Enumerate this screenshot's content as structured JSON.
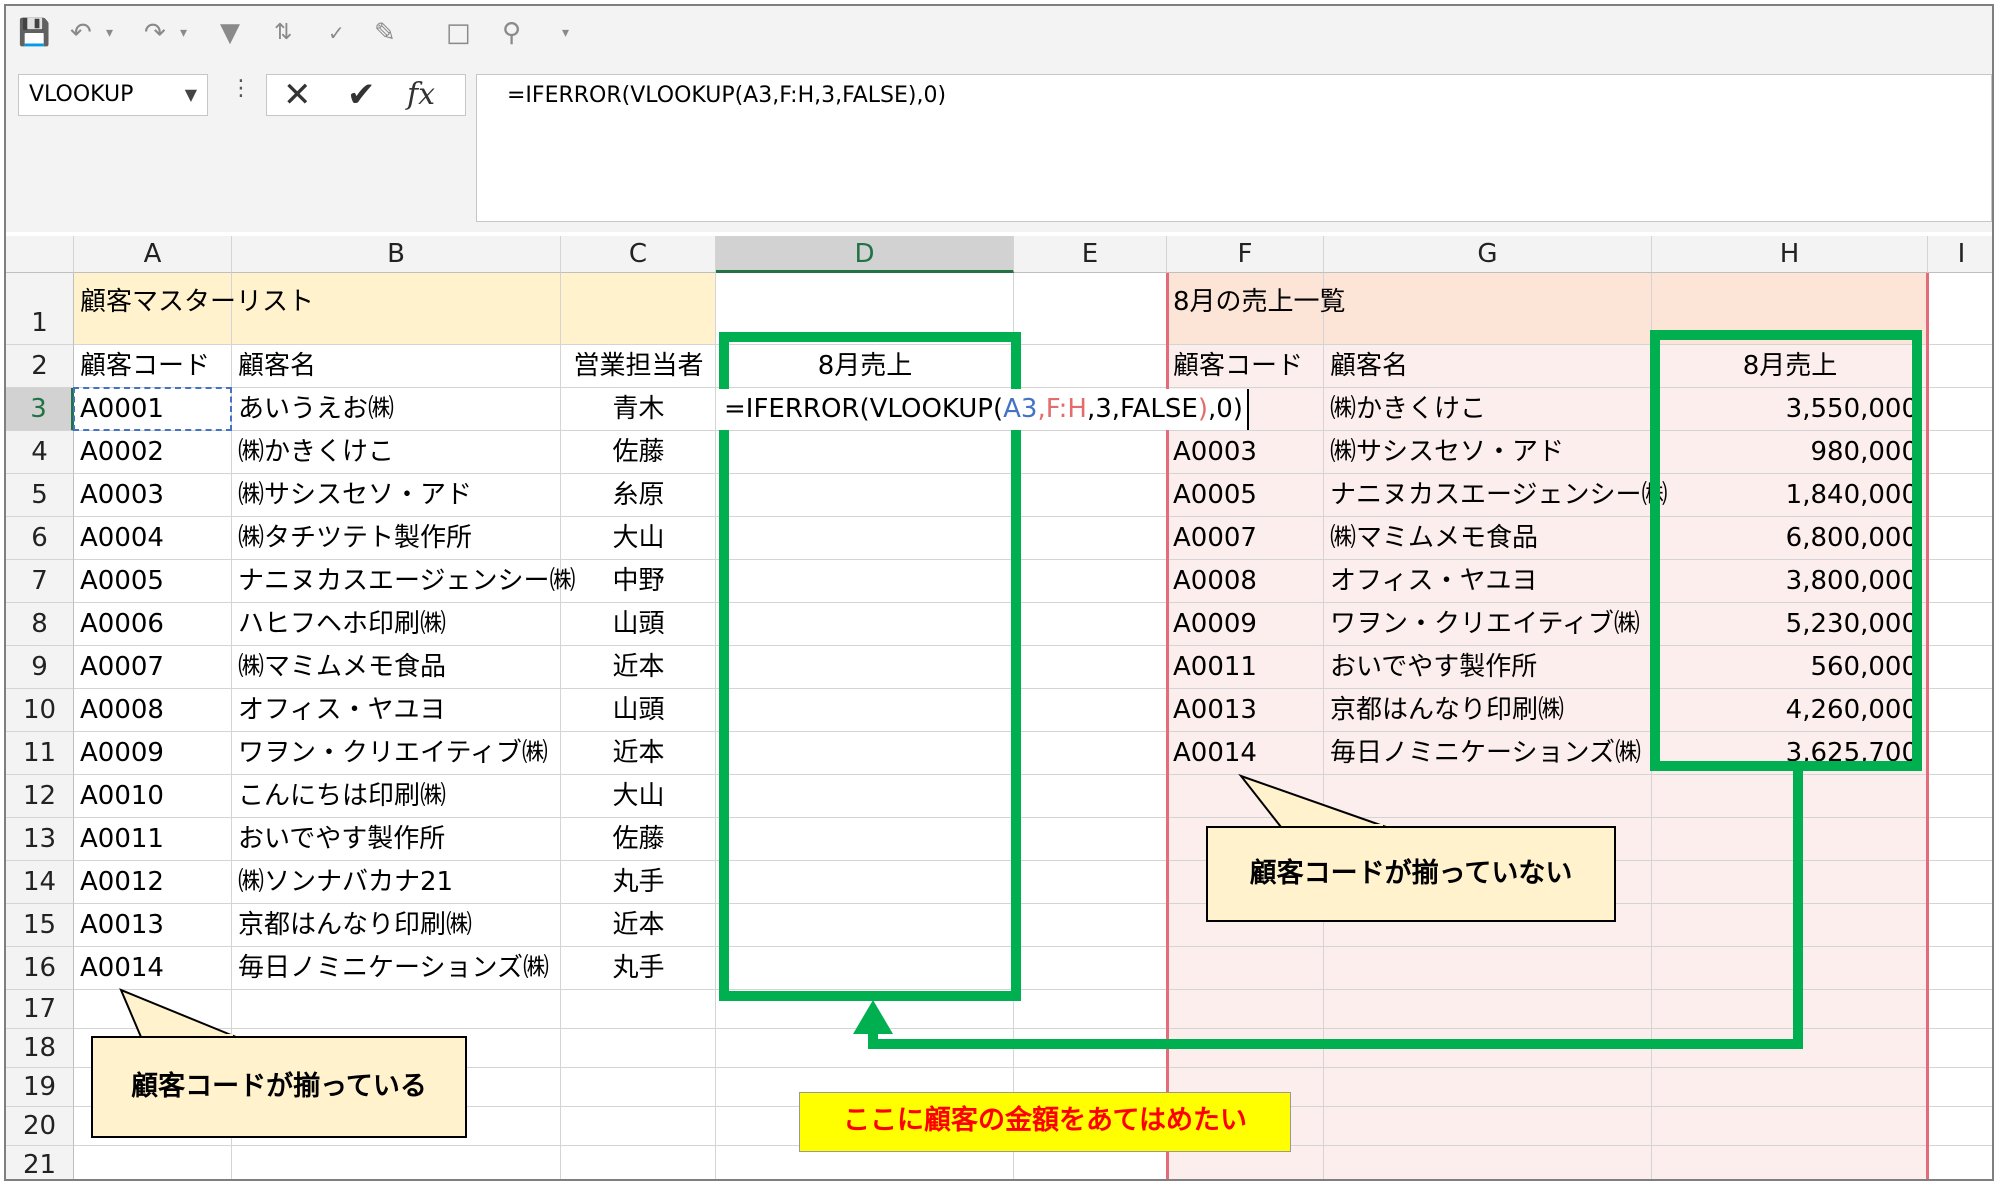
{
  "namebox": "VLOOKUP",
  "formula": "=IFERROR(VLOOKUP(A3,F:H,3,FALSE),0)",
  "editing": {
    "prefix": "=IFERROR(VLOOKUP(",
    "a3": "A3",
    "c1": ",",
    "fh": "F:H",
    "suffix1": ",3,FALSE",
    "paren": ")",
    "suffix2": ",0)"
  },
  "columns": [
    "A",
    "B",
    "C",
    "D",
    "E",
    "F",
    "G",
    "H",
    "I"
  ],
  "rows": [
    "1",
    "2",
    "3",
    "4",
    "5",
    "6",
    "7",
    "8",
    "9",
    "10",
    "11",
    "12",
    "13",
    "14",
    "15",
    "16",
    "17",
    "18",
    "19",
    "20",
    "21"
  ],
  "master": {
    "title": "顧客マスターリスト",
    "headers": {
      "code": "顧客コード",
      "name": "顧客名",
      "rep": "営業担当者",
      "sales": "8月売上"
    },
    "records": [
      {
        "code": "A0001",
        "name": "あいうえお㈱",
        "rep": "青木"
      },
      {
        "code": "A0002",
        "name": "㈱かきくけこ",
        "rep": "佐藤"
      },
      {
        "code": "A0003",
        "name": "㈱サシスセソ・アド",
        "rep": "糸原"
      },
      {
        "code": "A0004",
        "name": "㈱タチツテト製作所",
        "rep": "大山"
      },
      {
        "code": "A0005",
        "name": "ナニヌカスエージェンシー㈱",
        "rep": "中野"
      },
      {
        "code": "A0006",
        "name": "ハヒフヘホ印刷㈱",
        "rep": "山頭"
      },
      {
        "code": "A0007",
        "name": "㈱マミムメモ食品",
        "rep": "近本"
      },
      {
        "code": "A0008",
        "name": "オフィス・ヤユヨ",
        "rep": "山頭"
      },
      {
        "code": "A0009",
        "name": "ワヲン・クリエイティブ㈱",
        "rep": "近本"
      },
      {
        "code": "A0010",
        "name": "こんにちは印刷㈱",
        "rep": "大山"
      },
      {
        "code": "A0011",
        "name": "おいでやす製作所",
        "rep": "佐藤"
      },
      {
        "code": "A0012",
        "name": "㈱ソンナバカナ21",
        "rep": "丸手"
      },
      {
        "code": "A0013",
        "name": "京都はんなり印刷㈱",
        "rep": "近本"
      },
      {
        "code": "A0014",
        "name": "毎日ノミニケーションズ㈱",
        "rep": "丸手"
      }
    ]
  },
  "sales": {
    "title": "8月の売上一覧",
    "headers": {
      "code": "顧客コード",
      "name": "顧客名",
      "sales": "8月売上"
    },
    "records": [
      {
        "code": "",
        "name": "㈱かきくけこ",
        "amount": "3,550,000"
      },
      {
        "code": "A0003",
        "name": "㈱サシスセソ・アド",
        "amount": "980,000"
      },
      {
        "code": "A0005",
        "name": "ナニヌカスエージェンシー㈱",
        "amount": "1,840,000"
      },
      {
        "code": "A0007",
        "name": "㈱マミムメモ食品",
        "amount": "6,800,000"
      },
      {
        "code": "A0008",
        "name": "オフィス・ヤユヨ",
        "amount": "3,800,000"
      },
      {
        "code": "A0009",
        "name": "ワヲン・クリエイティブ㈱",
        "amount": "5,230,000"
      },
      {
        "code": "A0011",
        "name": "おいでやす製作所",
        "amount": "560,000"
      },
      {
        "code": "A0013",
        "name": "京都はんなり印刷㈱",
        "amount": "4,260,000"
      },
      {
        "code": "A0014",
        "name": "毎日ノミニケーションズ㈱",
        "amount": "3,625,700"
      }
    ]
  },
  "annotations": {
    "aligned": "顧客コードが揃っている",
    "not_aligned": "顧客コードが揃っていない",
    "apply_here": "ここに顧客の金額をあてはめたい"
  },
  "colors": {
    "accent_green": "#00b050",
    "excel_green": "#217346",
    "ref_blue": "#4472c4",
    "ref_red": "#e46c6c"
  }
}
